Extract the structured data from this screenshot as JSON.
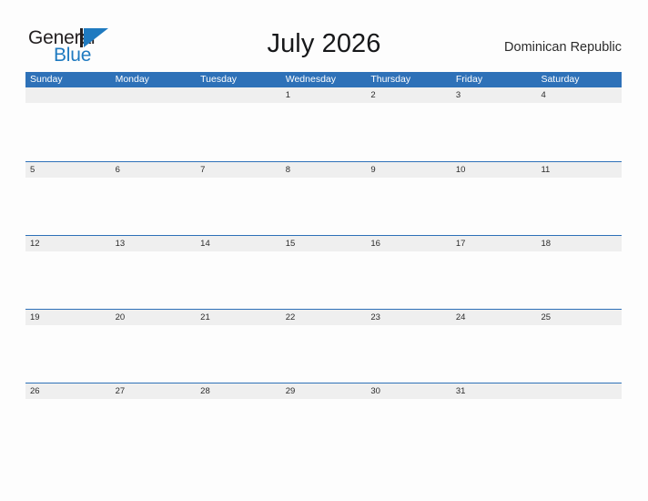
{
  "brand": {
    "name_part1": "General",
    "name_part2": "Blue",
    "mark_icon": "triangle-flag-icon",
    "accent_color": "#1f7ac0",
    "dark_color": "#231f20"
  },
  "header": {
    "title": "July 2026",
    "region": "Dominican Republic"
  },
  "calendar": {
    "month": "July",
    "year": "2026",
    "header_color": "#2e71b8",
    "band_color": "#efefef",
    "weekdays": [
      "Sunday",
      "Monday",
      "Tuesday",
      "Wednesday",
      "Thursday",
      "Friday",
      "Saturday"
    ],
    "weeks": [
      [
        "",
        "",
        "",
        "1",
        "2",
        "3",
        "4"
      ],
      [
        "5",
        "6",
        "7",
        "8",
        "9",
        "10",
        "11"
      ],
      [
        "12",
        "13",
        "14",
        "15",
        "16",
        "17",
        "18"
      ],
      [
        "19",
        "20",
        "21",
        "22",
        "23",
        "24",
        "25"
      ],
      [
        "26",
        "27",
        "28",
        "29",
        "30",
        "31",
        ""
      ]
    ]
  }
}
